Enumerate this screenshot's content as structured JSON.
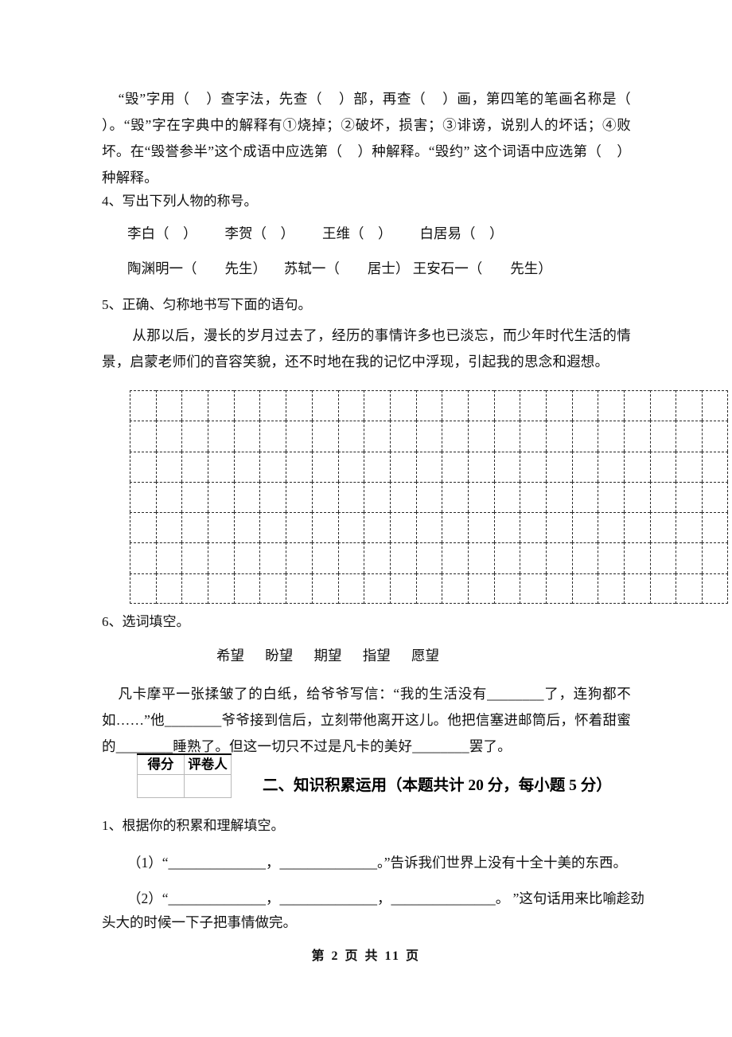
{
  "document": {
    "type": "exam-paper",
    "language": "zh-CN"
  },
  "question_3_continuation": {
    "text": "    “毁”字用（    ）查字法，先查（    ）部，再查（    ）画，第四笔的笔画名称是（    ）。“毁”字在字典中的解释有①烧掉；②破坏，损害；③诽谤，说别人的坏话；④败坏。在“毁誉参半”这个成语中应选第（    ）种解释。“毁约” 这个词语中应选第（    ）种解释。"
  },
  "question_4": {
    "label": "4、写出下列人物的称号。",
    "line1": "李白（    ）        李贺（    ）        王维（    ）        白居易（    ）",
    "line2": "陶渊明一（        先生）     苏轼一（        居士） 王安石一（        先生）"
  },
  "question_5": {
    "label": "5、正确、匀称地书写下面的语句。",
    "text": "        从那以后，漫长的岁月过去了，经历的事情许多也已淡忘，而少年时代生活的情景，启蒙老师们的音容笑貌，还不时地在我的记忆中浮现，引起我的思念和遐想。",
    "grid": {
      "columns": 23,
      "rows": 7,
      "style": "dashed"
    }
  },
  "question_6": {
    "label": "6、选词填空。",
    "word_bank": "希望      盼望      期望      指望      愿望",
    "passage": "    凡卡摩平一张揉皱了的白纸，给爷爷写信：“我的生活没有________了，连狗都不如……”他________爷爷接到信后，立刻带他离开这儿。他把信塞进邮筒后，怀着甜蜜的________睡熟了。但这一切只不过是凡卡的美好________罢了。"
  },
  "score_table": {
    "headers": [
      "得分",
      "评卷人"
    ],
    "values": [
      "",
      ""
    ]
  },
  "section_two": {
    "heading": "二、知识积累运用（本题共计 20 分，每小题 5 分）"
  },
  "section_two_q1": {
    "label": "1、根据你的积累和理解填空。",
    "item1": "（1）“______________，______________。”告诉我们世界上没有十全十美的东西。",
    "item2_line1": "（2）“______________，______________，_______________。 ”这句话用来比喻趁劲",
    "item2_line2": "头大的时候一下子把事情做完。"
  },
  "footer": {
    "text": "第 2 页 共 11 页"
  },
  "colors": {
    "text": "#111111",
    "grid_line": "#2b2b2b",
    "table_border": "#b9b9b9",
    "table_top_border": "#000000",
    "background": "#ffffff"
  }
}
